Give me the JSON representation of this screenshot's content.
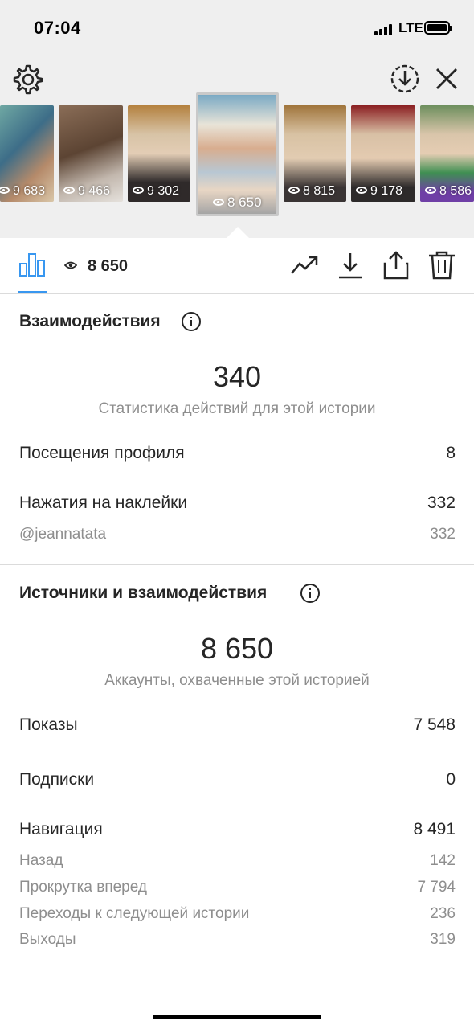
{
  "status_bar": {
    "time": "07:04",
    "network": "LTE"
  },
  "colors": {
    "accent": "#3897f0",
    "text": "#262626",
    "secondary": "#8e8e8e",
    "divider": "#dbdbdb",
    "top_background": "#efefef"
  },
  "header": {
    "left_icon": "gear-icon",
    "right_icons": [
      "download-circle-icon",
      "close-icon"
    ]
  },
  "story_strip": [
    {
      "views": "9 683",
      "selected": false
    },
    {
      "views": "9 466",
      "selected": false
    },
    {
      "views": "9 302",
      "selected": false
    },
    {
      "views": "8 650",
      "selected": true
    },
    {
      "views": "8 815",
      "selected": false
    },
    {
      "views": "9 178",
      "selected": false
    },
    {
      "views": "8 586",
      "selected": false
    }
  ],
  "toolbar": {
    "views": "8 650",
    "icons": [
      "bar-chart-icon",
      "eye-icon",
      "trending-icon",
      "download-icon",
      "share-icon",
      "trash-icon"
    ]
  },
  "interactions": {
    "title": "Взаимодействия",
    "total": "340",
    "caption": "Статистика действий для этой истории",
    "profile_visits_label": "Посещения профиля",
    "profile_visits_value": "8",
    "sticker_taps_label": "Нажатия на наклейки",
    "sticker_taps_value": "332",
    "sticker_handle_label": "@jeannatata",
    "sticker_handle_value": "332"
  },
  "discovery": {
    "title": "Источники и взаимодействия",
    "reach": "8 650",
    "caption": "Аккаунты, охваченные этой историей",
    "impressions_label": "Показы",
    "impressions_value": "7 548",
    "follows_label": "Подписки",
    "follows_value": "0",
    "navigation_label": "Навигация",
    "navigation_value": "8 491",
    "back_label": "Назад",
    "back_value": "142",
    "forward_label": "Прокрутка вперед",
    "forward_value": "7 794",
    "next_story_label": "Переходы к следующей истории",
    "next_story_value": "236",
    "exits_label": "Выходы",
    "exits_value": "319"
  }
}
